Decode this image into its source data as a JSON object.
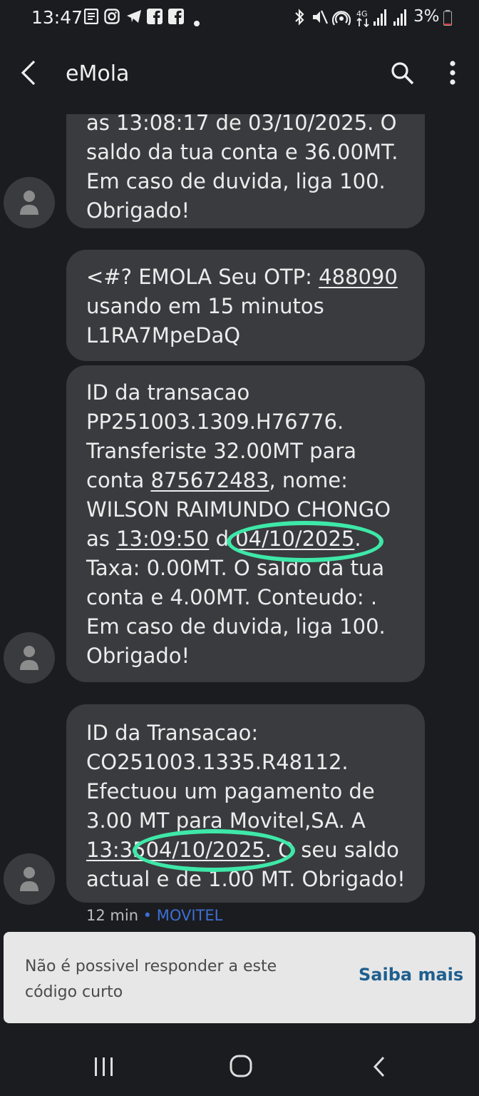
{
  "status_bar": {
    "time": "13:47",
    "battery": "3%",
    "icons": [
      "notes-icon",
      "instagram-icon",
      "telegram-icon",
      "facebook-icon",
      "facebook-icon",
      "dot-icon",
      "bluetooth-icon",
      "mute-icon",
      "hotspot-icon",
      "data-4g-icon",
      "signal-icon",
      "signal-icon",
      "battery-icon"
    ]
  },
  "app_bar": {
    "title": "eMola",
    "back_icon": "arrow-back-icon",
    "search_icon": "search-icon",
    "menu_icon": "more-vert-icon"
  },
  "messages": [
    {
      "lines": [
        "as 13:08:17 de 03/10/2025. O",
        "saldo da tua conta e 36.00MT.",
        "Em caso de duvida, liga 100.",
        "Obrigado!"
      ]
    },
    {
      "line1_prefix": "<#? EMOLA Seu OTP: ",
      "otp": "488090",
      "line2": "usando em 15 minutos",
      "line3": "L1RA7MpeDaQ"
    },
    {
      "line1": "ID da transacao",
      "line2": "PP251003.1309.H76776.",
      "line3": "Transferiste 32.00MT para",
      "line4_prefix": "conta ",
      "account": "875672483",
      "line4_suffix": ", nome:",
      "line5": "WILSON RAIMUNDO CHONGO",
      "line6_prefix": "as ",
      "time": "13:09:50",
      "line6_mid": " d ",
      "date": "04/10/2025",
      "line6_suffix": ".",
      "line7": "Taxa: 0.00MT. O saldo da tua",
      "line8": "conta e 4.00MT. Conteudo: .",
      "line9": "Em caso de duvida, liga 100.",
      "line10": "Obrigado!"
    },
    {
      "line1": "ID da Transacao:",
      "line2": "CO251003.1335.R48112.",
      "line3": "Efectuou um pagamento de",
      "line4": "3.00 MT para Movitel,SA. A",
      "time": "13:35",
      "date": "04/10/2025",
      "line5_suffix": ". O seu saldo",
      "line6": "actual e de 1.00 MT. Obrigado!"
    }
  ],
  "meta": {
    "time_ago": "12 min",
    "separator": " • ",
    "carrier": "MOVITEL"
  },
  "banner": {
    "message": "Não é possivel responder a este código curto",
    "link": "Saiba mais"
  },
  "nav_bar": {
    "recents_icon": "recents-icon",
    "home_icon": "home-icon",
    "back_icon": "nav-back-icon"
  },
  "colors": {
    "background": "#1b1c1f",
    "bubble": "#3a3b3e",
    "highlight": "#3ee8a8",
    "carrier": "#3d6fd6",
    "banner": "#e7e7e7",
    "link": "#1f5f8f"
  }
}
